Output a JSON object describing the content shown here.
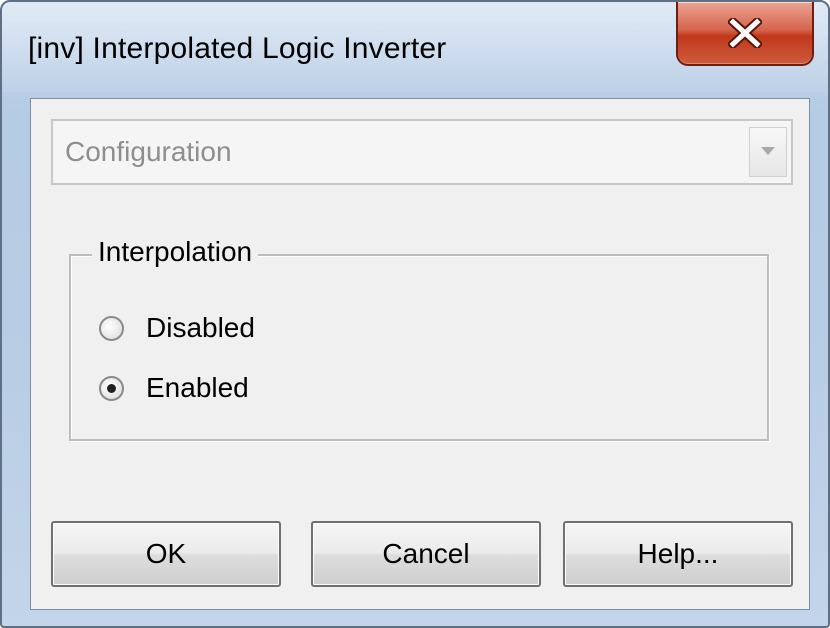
{
  "window": {
    "title": "[inv] Interpolated Logic Inverter",
    "close_icon": "close-icon"
  },
  "config": {
    "selected": "Configuration",
    "arrow_icon": "chevron-down-icon",
    "disabled": true
  },
  "interpolation": {
    "legend": "Interpolation",
    "options": [
      {
        "label": "Disabled",
        "checked": false
      },
      {
        "label": "Enabled",
        "checked": true
      }
    ]
  },
  "buttons": {
    "ok": "OK",
    "cancel": "Cancel",
    "help": "Help..."
  },
  "colors": {
    "close_button": "#c7452a",
    "client_bg": "#f0f0f0",
    "frame": "#b9cde5"
  }
}
